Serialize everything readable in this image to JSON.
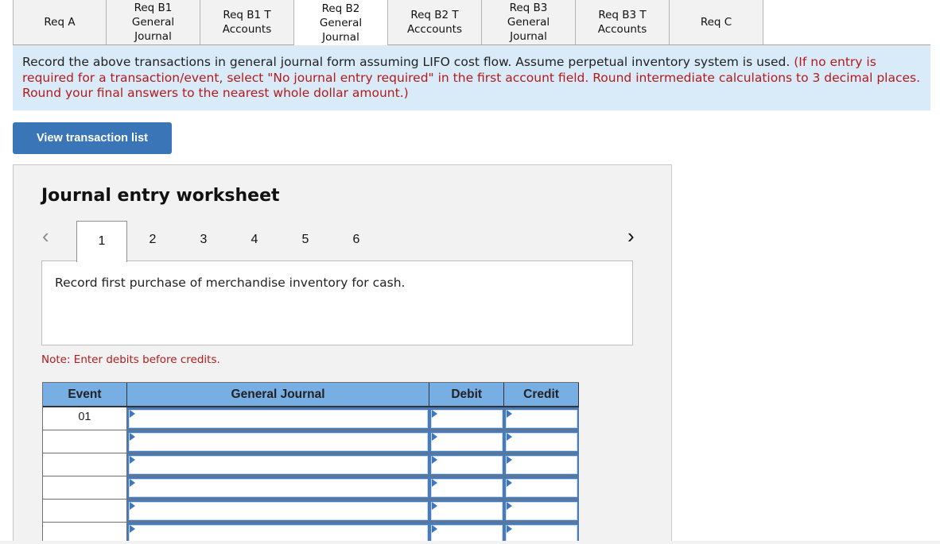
{
  "tabs": [
    {
      "label": "Req A",
      "active": false
    },
    {
      "label": "Req B1 General Journal",
      "active": false
    },
    {
      "label": "Req B1 T Accounts",
      "active": false
    },
    {
      "label": "Req B2 General Journal",
      "active": true
    },
    {
      "label": "Req B2 T Acccounts",
      "active": false
    },
    {
      "label": "Req B3 General Journal",
      "active": false
    },
    {
      "label": "Req B3 T Accounts",
      "active": false
    },
    {
      "label": "Req C",
      "active": false
    }
  ],
  "instructions": {
    "main": "Record the above transactions in general journal form assuming LIFO cost flow. Assume perpetual inventory system is used. ",
    "note": "(If no entry is required for a transaction/event, select \"No journal entry required\" in the first account field. Round intermediate calculations to 3 decimal places. Round your final answers to the nearest whole dollar amount.)"
  },
  "view_transaction_button": "View transaction list",
  "worksheet": {
    "title": "Journal entry worksheet",
    "prev_icon": "‹",
    "next_icon": "›",
    "pages": [
      "1",
      "2",
      "3",
      "4",
      "5",
      "6"
    ],
    "active_page": "1",
    "description": "Record first purchase of merchandise inventory for cash.",
    "note": "Note: Enter debits before credits.",
    "table": {
      "headers": {
        "event": "Event",
        "account": "General Journal",
        "debit": "Debit",
        "credit": "Credit"
      },
      "rows": [
        {
          "event": "01",
          "account": "",
          "debit": "",
          "credit": ""
        },
        {
          "event": "",
          "account": "",
          "debit": "",
          "credit": ""
        },
        {
          "event": "",
          "account": "",
          "debit": "",
          "credit": ""
        },
        {
          "event": "",
          "account": "",
          "debit": "",
          "credit": ""
        },
        {
          "event": "",
          "account": "",
          "debit": "",
          "credit": ""
        },
        {
          "event": "",
          "account": "",
          "debit": "",
          "credit": ""
        }
      ]
    }
  },
  "colors": {
    "instruction_bg": "#d9eaf8",
    "instruction_red": "#b31b1b",
    "button_blue": "#3a75b8",
    "table_header": "#77aee3",
    "input_border": "#4a7bb6"
  }
}
